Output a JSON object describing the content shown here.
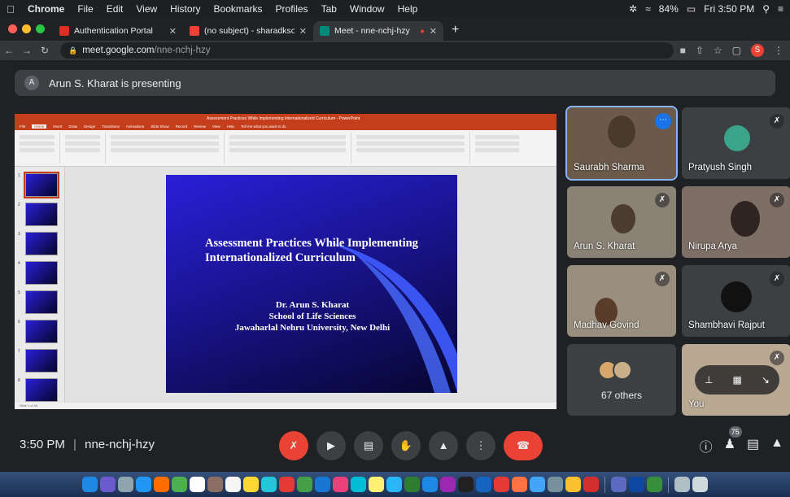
{
  "menubar": {
    "app": "Chrome",
    "items": [
      "File",
      "Edit",
      "View",
      "History",
      "Bookmarks",
      "Profiles",
      "Tab",
      "Window",
      "Help"
    ],
    "battery": "84%",
    "datetime": "Fri 3:50 PM"
  },
  "tabs": [
    {
      "title": "Authentication Portal",
      "favicon_color": "#d93025"
    },
    {
      "title": "(no subject) - sharadksoni@gm",
      "favicon_color": "#ea4335"
    },
    {
      "title": "Meet - nne-nchj-hzy",
      "favicon_color": "#00897b"
    }
  ],
  "address": {
    "host": "meet.google.com",
    "path": "/nne-nchj-hzy"
  },
  "profile_initial": "S",
  "banner": {
    "avatar": "A",
    "text": "Arun S. Kharat is presenting"
  },
  "slide": {
    "window_title": "Assessment Practices While Implementing Internationalized Curriculum - PowerPoint",
    "ribbon_tabs": [
      "File",
      "Home",
      "Insert",
      "Draw",
      "Design",
      "Transitions",
      "Animations",
      "Slide Show",
      "Record",
      "Review",
      "View",
      "Help",
      "Tell me what you want to do"
    ],
    "thumb_numbers": [
      "1",
      "2",
      "3",
      "4",
      "5",
      "6",
      "7",
      "8"
    ],
    "title": "Assessment Practices While Implementing Internationalized Curriculum",
    "author": "Dr. Arun S. Kharat",
    "school": "School of Life Sciences",
    "university": "Jawaharlal Nehru University, New Delhi",
    "status_text": "Slide 1 of 44"
  },
  "participants": [
    {
      "name": "Saurabh Sharma"
    },
    {
      "name": "Pratyush Singh"
    },
    {
      "name": "Arun S. Kharat"
    },
    {
      "name": "Nirupa Arya"
    },
    {
      "name": "Madhav Govind"
    },
    {
      "name": "Shambhavi Rajput"
    },
    {
      "name": "67 others"
    },
    {
      "name": "You"
    }
  ],
  "bottom": {
    "time": "3:50 PM",
    "separator": "|",
    "meeting_code": "nne-nchj-hzy",
    "people_count": "75"
  },
  "colors": {
    "accent": "#1a73e8",
    "hangup": "#ea4335",
    "powerpoint": "#c43e1c"
  }
}
